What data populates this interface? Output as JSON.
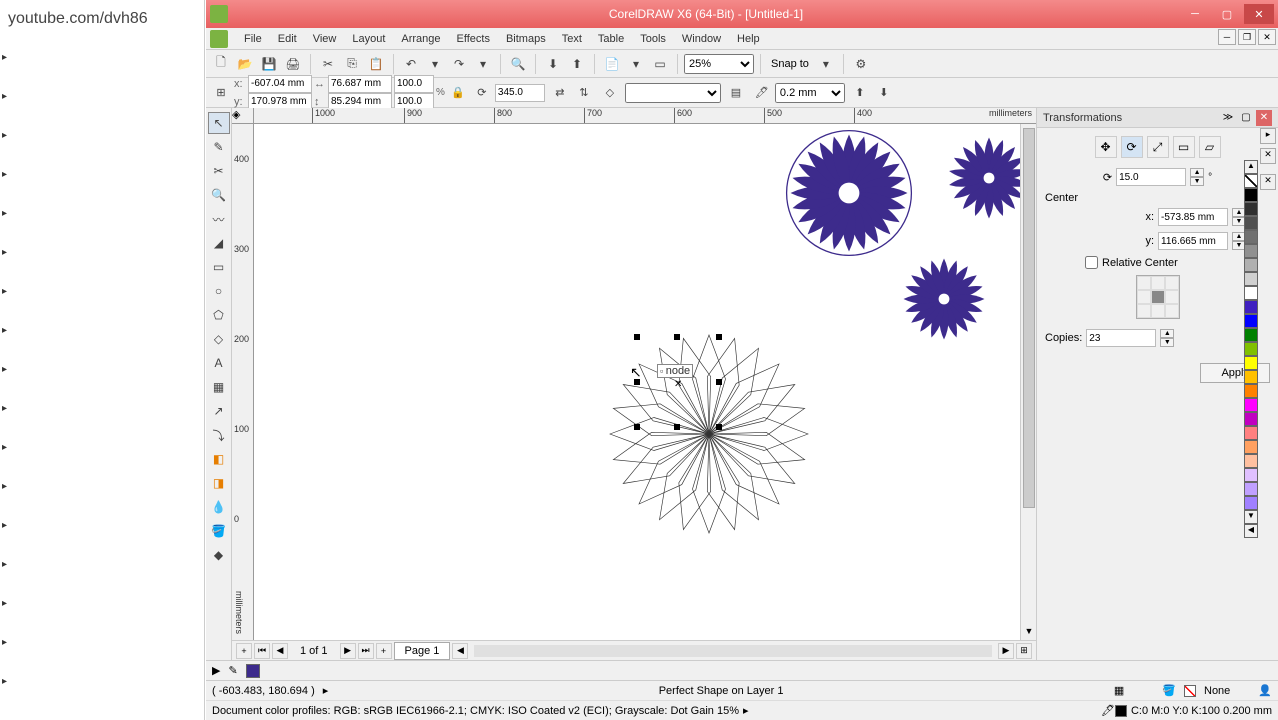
{
  "url": "youtube.com/dvh86",
  "window": {
    "title": "CorelDRAW X6 (64-Bit) - [Untitled-1]"
  },
  "menu": {
    "file": "File",
    "edit": "Edit",
    "view": "View",
    "layout": "Layout",
    "arrange": "Arrange",
    "effects": "Effects",
    "bitmaps": "Bitmaps",
    "text": "Text",
    "table": "Table",
    "tools": "Tools",
    "window": "Window",
    "help": "Help"
  },
  "toolbar": {
    "zoom": "25%",
    "snap_to": "Snap to"
  },
  "propbar": {
    "x": "-607.04 mm",
    "y": "170.978 mm",
    "w": "76.687 mm",
    "h": "85.294 mm",
    "scale_x": "100.0",
    "scale_y": "100.0",
    "rotation": "345.0",
    "outline_width": "0.2 mm"
  },
  "ruler": {
    "h_ticks": [
      "1000",
      "900",
      "800",
      "700",
      "600",
      "500",
      "400"
    ],
    "units": "millimeters",
    "v_ticks": [
      "400",
      "300",
      "200",
      "100",
      "0"
    ],
    "v_units": "millimeters"
  },
  "docker": {
    "title": "Transformations",
    "angle": "15.0",
    "center_label": "Center",
    "x_label": "x:",
    "y_label": "y:",
    "x": "-573.85 mm",
    "y": "116.665 mm",
    "relative_center": "Relative Center",
    "copies_label": "Copies:",
    "copies": "23",
    "apply": "Apply"
  },
  "page": {
    "info": "1 of 1",
    "tab": "Page 1"
  },
  "status": {
    "cursor": "( -603.483, 180.694 )",
    "selection": "Perfect Shape on Layer 1",
    "fill_none": "None",
    "outline_spec": "C:0 M:0 Y:0 K:100  0.200 mm",
    "profiles": "Document color profiles: RGB: sRGB IEC61966-2.1; CMYK: ISO Coated v2 (ECI); Grayscale: Dot Gain 15%"
  },
  "palette_colors": [
    "#000000",
    "#404040",
    "#606060",
    "#808080",
    "#a0a0a0",
    "#c0c0c0",
    "#e0e0e0",
    "#ffffff",
    "#6a00ff",
    "#0000ff",
    "#00a000",
    "#80c000",
    "#ffff00",
    "#ff8000",
    "#ffa040",
    "#ff00ff",
    "#c000c0",
    "#ff8080",
    "#ffc0c0",
    "#e0d0ff",
    "#d0c0ff",
    "#c0b0ff"
  ],
  "node_hint": "node"
}
